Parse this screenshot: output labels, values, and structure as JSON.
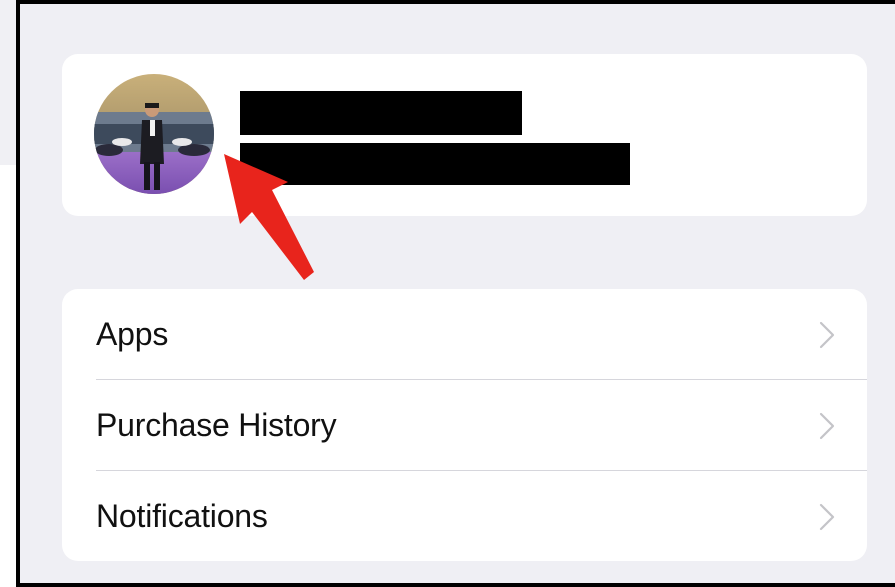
{
  "menu": {
    "items": [
      {
        "label": "Apps",
        "icon": "chevron-right-icon"
      },
      {
        "label": "Purchase History",
        "icon": "chevron-right-icon"
      },
      {
        "label": "Notifications",
        "icon": "chevron-right-icon"
      }
    ]
  },
  "profile": {
    "avatar_icon": "profile-photo",
    "name_redacted": true,
    "email_redacted": true
  },
  "annotation": {
    "arrow_color": "#e8241c",
    "arrow_target": "avatar"
  },
  "colors": {
    "background": "#efeff4",
    "card": "#ffffff",
    "text": "#111111",
    "chevron": "#c4c4c8",
    "divider": "#d6d6dc"
  }
}
